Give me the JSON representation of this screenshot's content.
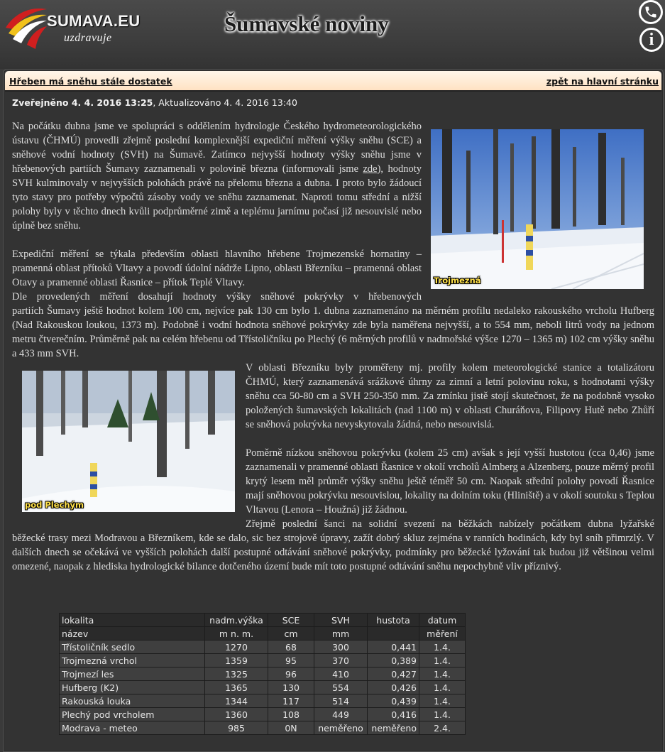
{
  "header": {
    "logo_text": "SUMAVA.EU",
    "logo_sub": "uzdravuje",
    "site_title": "Šumavské noviny",
    "phone_icon": "phone-icon",
    "info_icon": "info-icon"
  },
  "topbar": {
    "article_title": "Hřeben má sněhu stále dostatek",
    "back_link": "zpět na hlavní stránku"
  },
  "meta": {
    "published_label": "Zveřejněno 4. 4. 2016 13:25",
    "updated_label": ", Aktualizováno 4. 4. 2016 13:40"
  },
  "article": {
    "p1_before_link": "Na počátku dubna jsme ve spolupráci s oddělením hydrologie Českého hydrometeorologického ústavu (ČHMÚ) provedli zřejmě poslední komplexnější expediční měření výšky sněhu (SCE) a sněhové vodní hodnoty (SVH) na Šumavě. Zatímco nejvyšší hodnoty výšky sněhu jsme v hřebenových partiích Šumavy zaznamenali v polovině března (informovali jsme ",
    "p1_link": "zde",
    "p1_after_link": "), hodnoty SVH kulminovaly v nejvyšších polohách právě na přelomu března a dubna. I proto bylo žádoucí tyto stavy pro potřeby výpočtů zásoby vody ve sněhu zaznamenat. Naproti tomu střední a nižší polohy byly v těchto dnech kvůli podprůměrné zimě a teplému jarnímu počasí již nesouvislé nebo úplně bez sněhu.",
    "p2": "Expediční měření se týkala především oblasti hlavního hřebene Trojmezenské hornatiny – pramenná oblast přítoků Vltavy a povodí údolní nádrže Lipno, oblasti Březníku – pramenná oblast Otavy a pramenné oblasti Řasnice – přítok Teplé Vltavy.",
    "p3a": "Dle provedených měření dosahují hodnoty výšky sněhové pokrývky v hřebenových",
    "p3b": "partiích Šumavy ještě hodnot kolem 100 cm, nejvíce pak 130 cm bylo 1. dubna zaznamenáno na měrném profilu nedaleko rakouského vrcholu Hufberg (Nad Rakouskou loukou, 1373 m). Podobně i vodní hodnota sněhové pokrývky zde byla naměřena nejvyšší, a to 554 mm, neboli litrů vody na jednom metru čtverečním. Průměrně pak na celém hřebenu od Třístoličníku po Plechý (6 měrných profilů v nadmořské výšce 1270 – 1365 m) 102 cm výšky sněhu a 433 mm SVH.",
    "p4": "V oblasti Březníku byly proměřeny mj. profily kolem meteorologické stanice a totalizátoru ČHMÚ, který zaznamenává srážkové úhrny za zimní a letní polovinu roku, s hodnotami výšky sněhu cca 50-80 cm a SVH 250-350 mm. Za zmínku jistě stojí skutečnost, že na podobně vysoko položených šumavských lokalitách (nad 1100 m) v oblasti Churáňova, Filipovy Hutě nebo Zhůří se sněhová pokrývka nevyskytovala žádná, nebo nesouvislá.",
    "p5": "Poměrně nízkou sněhovou pokrývku (kolem 25 cm) avšak s její vyšší hustotou (cca 0,46) jsme zaznamenali v pramenné oblasti Řasnice v okolí vrcholů Almberg a Alzenberg, pouze měrný profil krytý lesem měl průměr výšky sněhu ještě téměř 50 cm. Naopak střední polohy povodí Řasnice mají sněhovou pokrývku nesouvislou, lokality na dolním toku (Hliniště) a v okolí soutoku s Teplou Vltavou (Lenora – Houžná) již žádnou.",
    "p6a": "Zřejmě poslední šanci na solidní svezení na běžkách nabízely počátkem dubna lyžařské",
    "p6b": "běžecké trasy mezi Modravou a Březníkem, kde se dalo, sic bez strojově úpravy, zažít dobrý skluz zejména v ranních hodinách, kdy byl sníh přimrzlý. V dalších dnech se očekává ve vyšších polohách další postupné odtávání sněhové pokrývky, podmínky pro běžecké lyžování tak budou již většinou velmi omezené, naopak z hlediska hydrologické bilance dotčeného území bude mít toto postupné odtávání sněhu nepochybně vliv příznivý."
  },
  "photos": {
    "photo1_caption": "Trojmezná",
    "photo2_caption": "pod Plechým"
  },
  "table": {
    "header1": [
      "lokalita",
      "nadm.výška",
      "SCE",
      "SVH",
      "hustota",
      "datum"
    ],
    "header2": [
      "název",
      "m n. m.",
      "cm",
      "mm",
      "",
      "měření"
    ],
    "rows": [
      [
        "Třístoličník sedlo",
        "1270",
        "68",
        "300",
        "0,441",
        "1.4."
      ],
      [
        "Trojmezná vrchol",
        "1359",
        "95",
        "370",
        "0,389",
        "1.4."
      ],
      [
        "Trojmezí les",
        "1325",
        "96",
        "410",
        "0,427",
        "1.4."
      ],
      [
        "Hufberg (K2)",
        "1365",
        "130",
        "554",
        "0,426",
        "1.4."
      ],
      [
        "Rakouská louka",
        "1344",
        "117",
        "514",
        "0,439",
        "1.4."
      ],
      [
        "Plechý pod vrcholem",
        "1360",
        "108",
        "449",
        "0,416",
        "1.4."
      ],
      [
        "Modrava - meteo",
        "985",
        "0N",
        "neměřeno",
        "neměřeno",
        "2.4."
      ]
    ]
  }
}
